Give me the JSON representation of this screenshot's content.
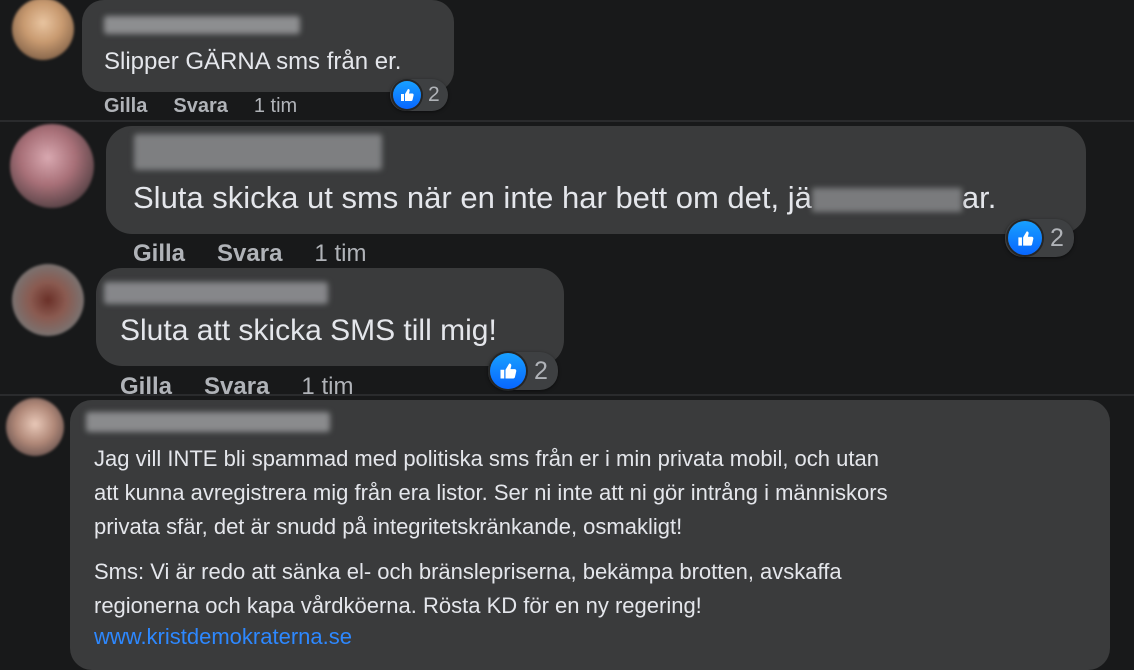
{
  "comments": [
    {
      "text": "Slipper GÄRNA sms från er.",
      "actions": {
        "like": "Gilla",
        "reply": "Svara",
        "time": "1 tim"
      },
      "reaction_count": "2"
    },
    {
      "text_start": "Sluta skicka ut sms när en inte har bett om det, jä",
      "text_end": "ar.",
      "actions": {
        "like": "Gilla",
        "reply": "Svara",
        "time": "1 tim"
      },
      "reaction_count": "2"
    },
    {
      "text": "Sluta att skicka SMS till mig!",
      "actions": {
        "like": "Gilla",
        "reply": "Svara",
        "time": "1 tim"
      },
      "reaction_count": "2"
    },
    {
      "paragraph1_lines": [
        "Jag vill INTE bli spammad med politiska sms från er i min privata mobil, och utan",
        "att kunna avregistrera mig från era listor. Ser ni inte att ni gör intrång i människors",
        "privata sfär, det är snudd på integritetskränkande, osmakligt!"
      ],
      "paragraph2_lines": [
        "Sms: Vi är redo att sänka el- och bränslepriserna, bekämpa brotten, avskaffa",
        "regionerna och kapa vårdköerna. Rösta KD för en ny regering!"
      ],
      "link": "www.kristdemokraterna.se"
    }
  ],
  "colors": {
    "background": "#18191a",
    "bubble": "#3a3b3c",
    "text": "#e4e6eb",
    "secondary_text": "#b0b3b8",
    "link": "#2d88ff",
    "like_blue": "#0866ff"
  },
  "icons": {
    "reaction": "thumbs-up-icon"
  }
}
